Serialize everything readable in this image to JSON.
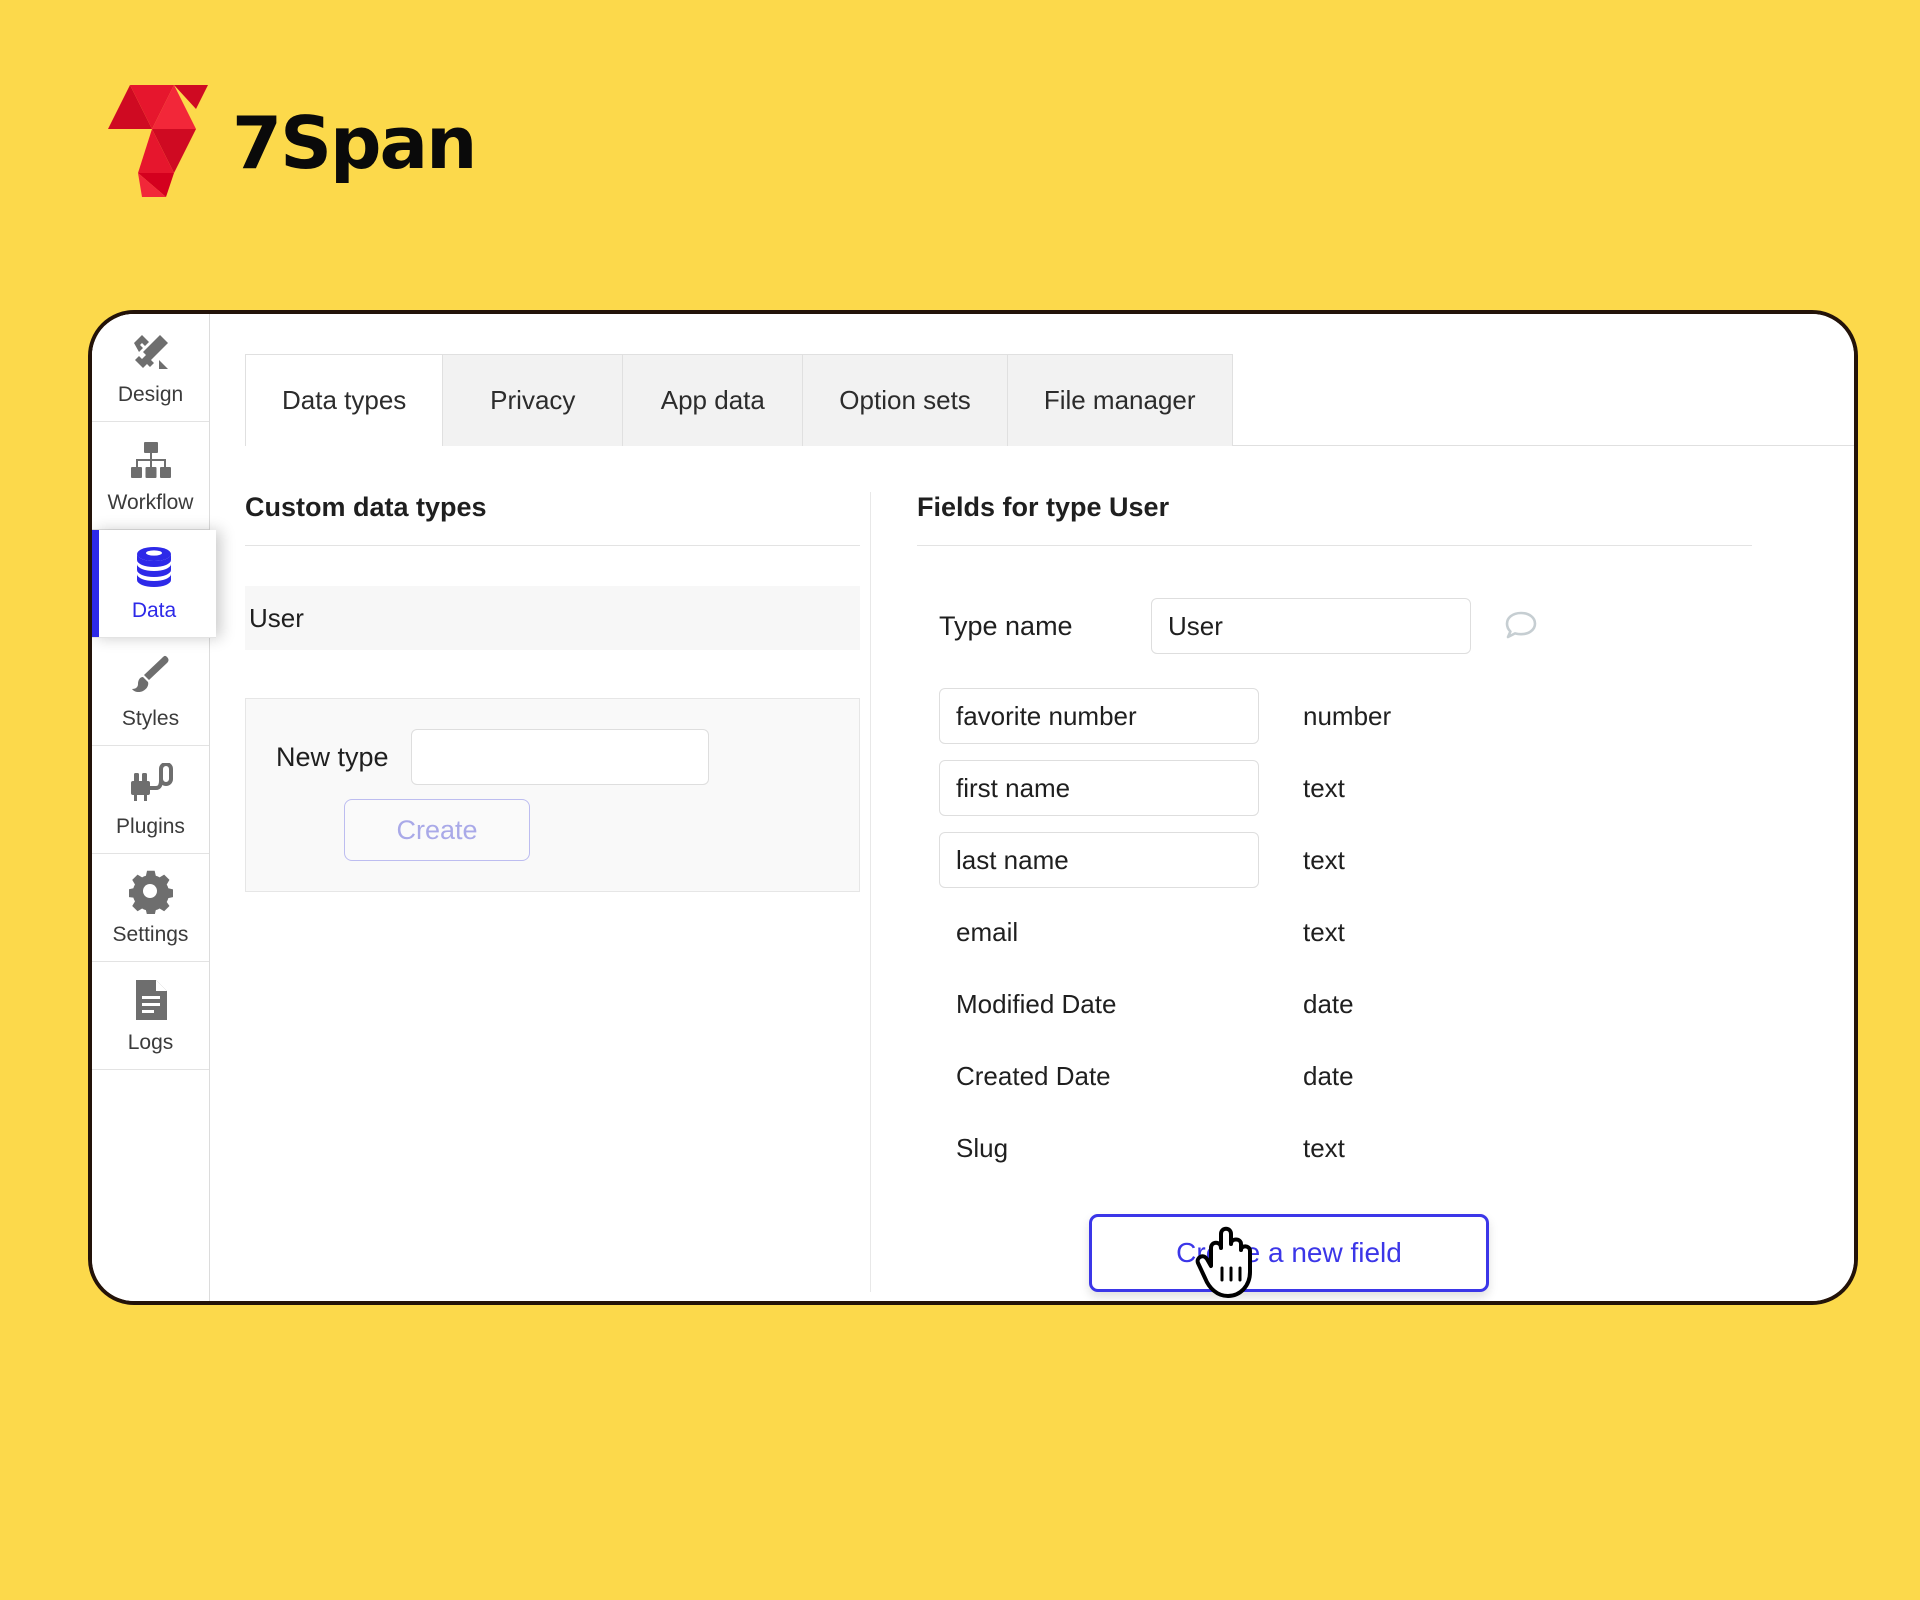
{
  "brand": {
    "name": "7Span",
    "logo_icon": "7span-triangles-logo",
    "logo_colors": [
      "#e6162d",
      "#cf0a22",
      "#f22739",
      "#d4001e"
    ],
    "background_color": "#fcd94b"
  },
  "sidebar": {
    "items": [
      {
        "label": "Design",
        "icon": "design-tools-icon",
        "active": false
      },
      {
        "label": "Workflow",
        "icon": "workflow-hierarchy-icon",
        "active": false
      },
      {
        "label": "Data",
        "icon": "database-icon",
        "active": true
      },
      {
        "label": "Styles",
        "icon": "paintbrush-icon",
        "active": false
      },
      {
        "label": "Plugins",
        "icon": "plug-icon",
        "active": false
      },
      {
        "label": "Settings",
        "icon": "gear-icon",
        "active": false
      },
      {
        "label": "Logs",
        "icon": "document-icon",
        "active": false
      }
    ],
    "active_color": "#2d29e8"
  },
  "tabs": [
    {
      "label": "Data types",
      "active": true
    },
    {
      "label": "Privacy",
      "active": false
    },
    {
      "label": "App data",
      "active": false
    },
    {
      "label": "Option sets",
      "active": false
    },
    {
      "label": "File manager",
      "active": false
    }
  ],
  "left_pane": {
    "title": "Custom data types",
    "types": [
      {
        "name": "User",
        "selected": true
      }
    ],
    "new_type": {
      "label": "New type",
      "value": "",
      "placeholder": "",
      "create_label": "Create",
      "create_disabled": true,
      "create_text_color": "#a9a9e8"
    }
  },
  "right_pane": {
    "title": "Fields for type User",
    "type_name": {
      "label": "Type name",
      "value": "User",
      "comment_icon": "speech-bubble-icon"
    },
    "fields": [
      {
        "name": "favorite number",
        "type": "number",
        "editable": true
      },
      {
        "name": "first name",
        "type": "text",
        "editable": true
      },
      {
        "name": "last name",
        "type": "text",
        "editable": true
      },
      {
        "name": "email",
        "type": "text",
        "editable": false
      },
      {
        "name": "Modified Date",
        "type": "date",
        "editable": false
      },
      {
        "name": "Created Date",
        "type": "date",
        "editable": false
      },
      {
        "name": "Slug",
        "type": "text",
        "editable": false
      }
    ],
    "create_field_label": "Create a new field",
    "create_field_color": "#3b36e8"
  },
  "cursor": {
    "icon": "pointing-hand-cursor"
  }
}
